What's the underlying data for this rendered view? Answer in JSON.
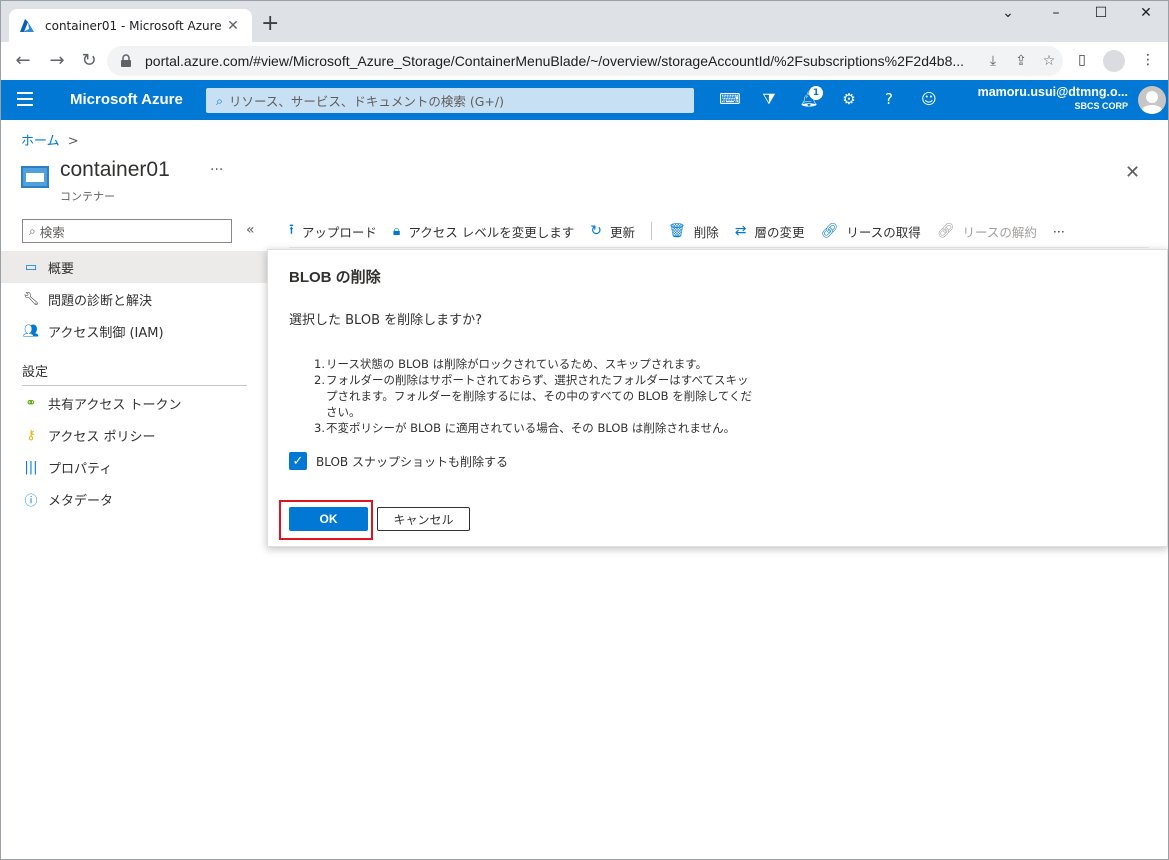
{
  "browser": {
    "tab_title": "container01 - Microsoft Azure",
    "tab_close": "✕",
    "new_tab": "+",
    "url": "portal.azure.com/#view/Microsoft_Azure_Storage/ContainerMenuBlade/~/overview/storageAccountId/%2Fsubscriptions%2F2d4b8...",
    "win_minimize": "–",
    "win_maximize": "☐",
    "win_close": "✕"
  },
  "azure": {
    "brand": "Microsoft Azure",
    "search_placeholder": "リソース、サービス、ドキュメントの検索 (G+/)",
    "notification_count": "1",
    "user_email": "mamoru.usui@dtmng.o...",
    "user_org": "SBCS CORP"
  },
  "breadcrumb": {
    "home": "ホーム",
    "sep": ">"
  },
  "resource": {
    "title": "container01",
    "subtitle": "コンテナー",
    "more": "···",
    "close": "✕"
  },
  "left_nav": {
    "search_placeholder": "検索",
    "collapse": "«",
    "items": [
      {
        "label": "概要",
        "icon": "overview-icon"
      },
      {
        "label": "問題の診断と解決",
        "icon": "wrench-icon"
      },
      {
        "label": "アクセス制御 (IAM)",
        "icon": "people-icon"
      }
    ],
    "section_label": "設定",
    "settings_items": [
      {
        "label": "共有アクセス トークン",
        "icon": "link-icon"
      },
      {
        "label": "アクセス ポリシー",
        "icon": "key-icon"
      },
      {
        "label": "プロパティ",
        "icon": "properties-icon"
      },
      {
        "label": "メタデータ",
        "icon": "info-icon"
      }
    ]
  },
  "toolbar": {
    "upload": "アップロード",
    "change_access": "アクセス レベルを変更します",
    "refresh": "更新",
    "delete": "削除",
    "change_tier": "層の変更",
    "acquire_lease": "リースの取得",
    "break_lease": "リースの解約",
    "more": "···"
  },
  "dialog": {
    "title": "BLOB の削除",
    "question": "選択した BLOB を削除しますか?",
    "notes": [
      {
        "num": "1.",
        "text": "リース状態の BLOB は削除がロックされているため、スキップされます。"
      },
      {
        "num": "2.",
        "text": "フォルダーの削除はサポートされておらず、選択されたフォルダーはすべてスキップされます。フォルダーを削除するには、その中のすべての BLOB を削除してください。"
      },
      {
        "num": "3.",
        "text": "不変ポリシーが BLOB に適用されている場合、その BLOB は削除されません。"
      }
    ],
    "checkbox_label": "BLOB スナップショットも削除する",
    "checkbox_checked": true,
    "ok_label": "OK",
    "cancel_label": "キャンセル"
  },
  "colors": {
    "azure_blue": "#0078d4",
    "highlight_red": "#e0141e"
  }
}
